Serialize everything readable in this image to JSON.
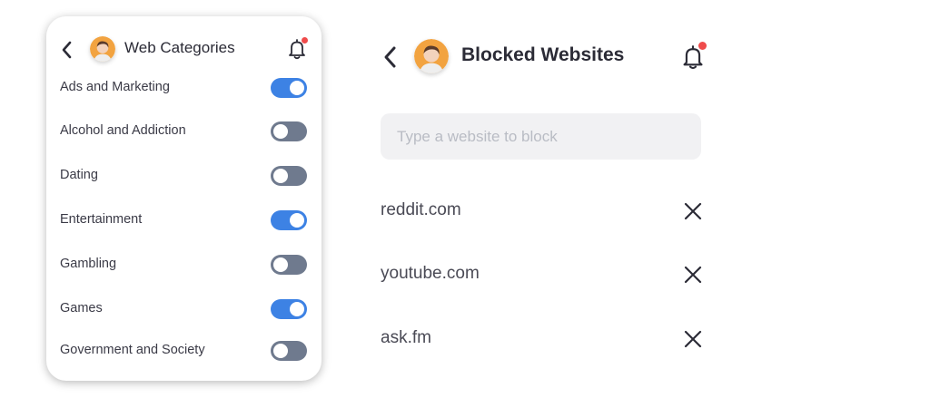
{
  "categories_screen": {
    "title": "Web Categories",
    "notification_badge": true,
    "items": [
      {
        "label": "Ads and Marketing",
        "enabled": true
      },
      {
        "label": "Alcohol and Addiction",
        "enabled": false
      },
      {
        "label": "Dating",
        "enabled": false
      },
      {
        "label": "Entertainment",
        "enabled": true
      },
      {
        "label": "Gambling",
        "enabled": false
      },
      {
        "label": "Games",
        "enabled": true
      },
      {
        "label": "Government and Society",
        "enabled": false
      }
    ]
  },
  "blocked_screen": {
    "title": "Blocked Websites",
    "notification_badge": true,
    "input": {
      "placeholder": "Type a website to block",
      "value": ""
    },
    "sites": [
      {
        "label": "reddit.com"
      },
      {
        "label": "youtube.com"
      },
      {
        "label": "ask.fm"
      }
    ]
  },
  "icons": {
    "back": "chevron-left-icon",
    "bell": "bell-icon",
    "remove": "close-icon",
    "avatar": "user-avatar"
  },
  "colors": {
    "toggle_on": "#3d82e4",
    "toggle_off": "#6f7a8e",
    "notification_dot": "#ef4b4b",
    "input_background": "#f1f1f3"
  }
}
